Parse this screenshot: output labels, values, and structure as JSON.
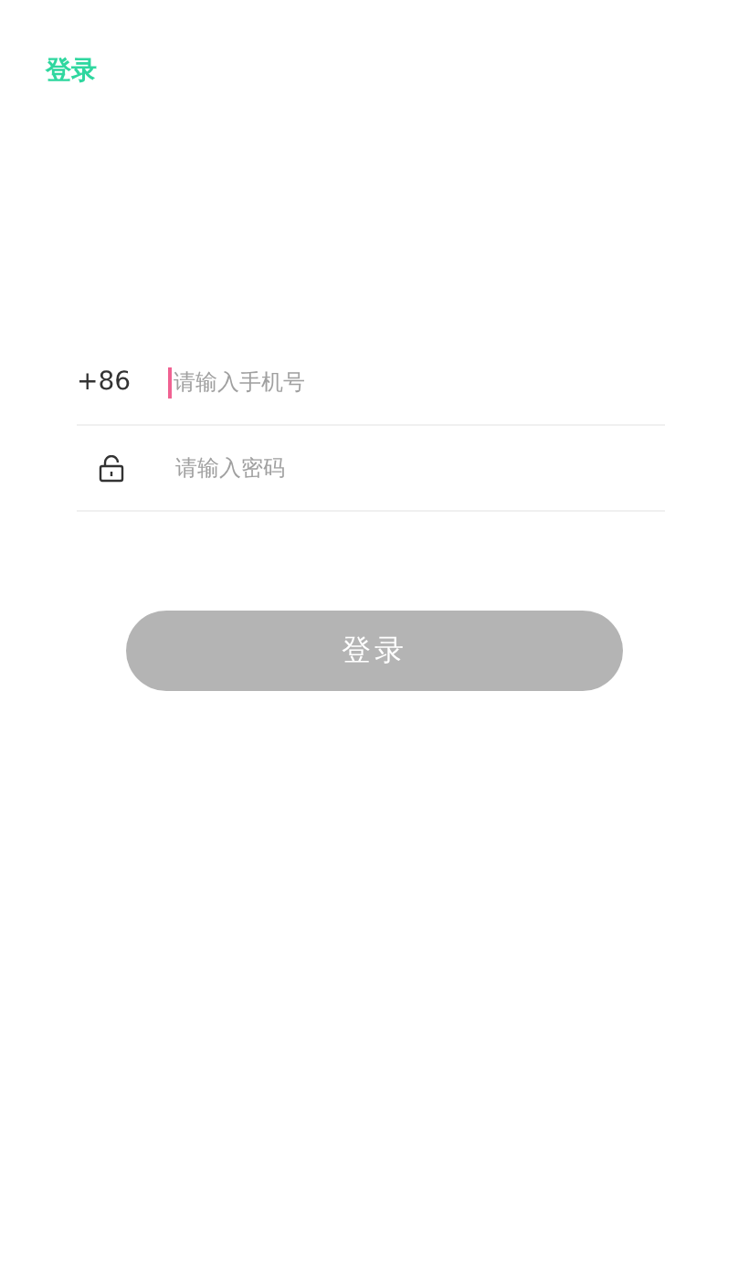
{
  "header": {
    "title": "登录"
  },
  "form": {
    "phone": {
      "prefix": "+86",
      "placeholder": "请输入手机号",
      "focused": true
    },
    "password": {
      "placeholder": "请输入密码"
    }
  },
  "submit": {
    "label": "登录",
    "disabled": true
  }
}
